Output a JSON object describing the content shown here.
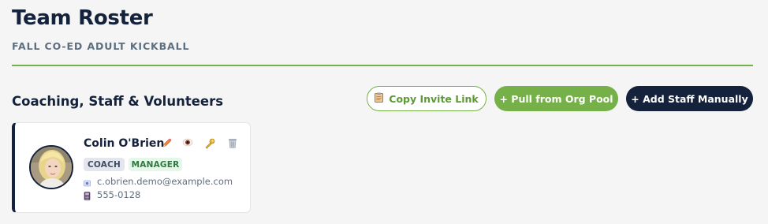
{
  "header": {
    "title": "Team Roster",
    "subtitle": "FALL CO-ED ADULT KICKBALL"
  },
  "section": {
    "title": "Coaching, Staff & Volunteers"
  },
  "toolbar": {
    "invite_label": "Copy Invite Link",
    "invite_icon": "clipboard-icon",
    "pool_label": "+ Pull from Org Pool",
    "manual_label": "+ Add Staff Manually"
  },
  "staff": [
    {
      "name": "Colin O'Brien",
      "roles": [
        "COACH",
        "MANAGER"
      ],
      "email": "c.obrien.demo@example.com",
      "phone": "555-0128",
      "actions": [
        "edit-pencil-icon",
        "view-eye-icon",
        "key-icon",
        "trash-icon"
      ]
    }
  ],
  "colors": {
    "accent_green": "#76b048",
    "navy": "#15223c",
    "background": "#f4f5f4"
  }
}
